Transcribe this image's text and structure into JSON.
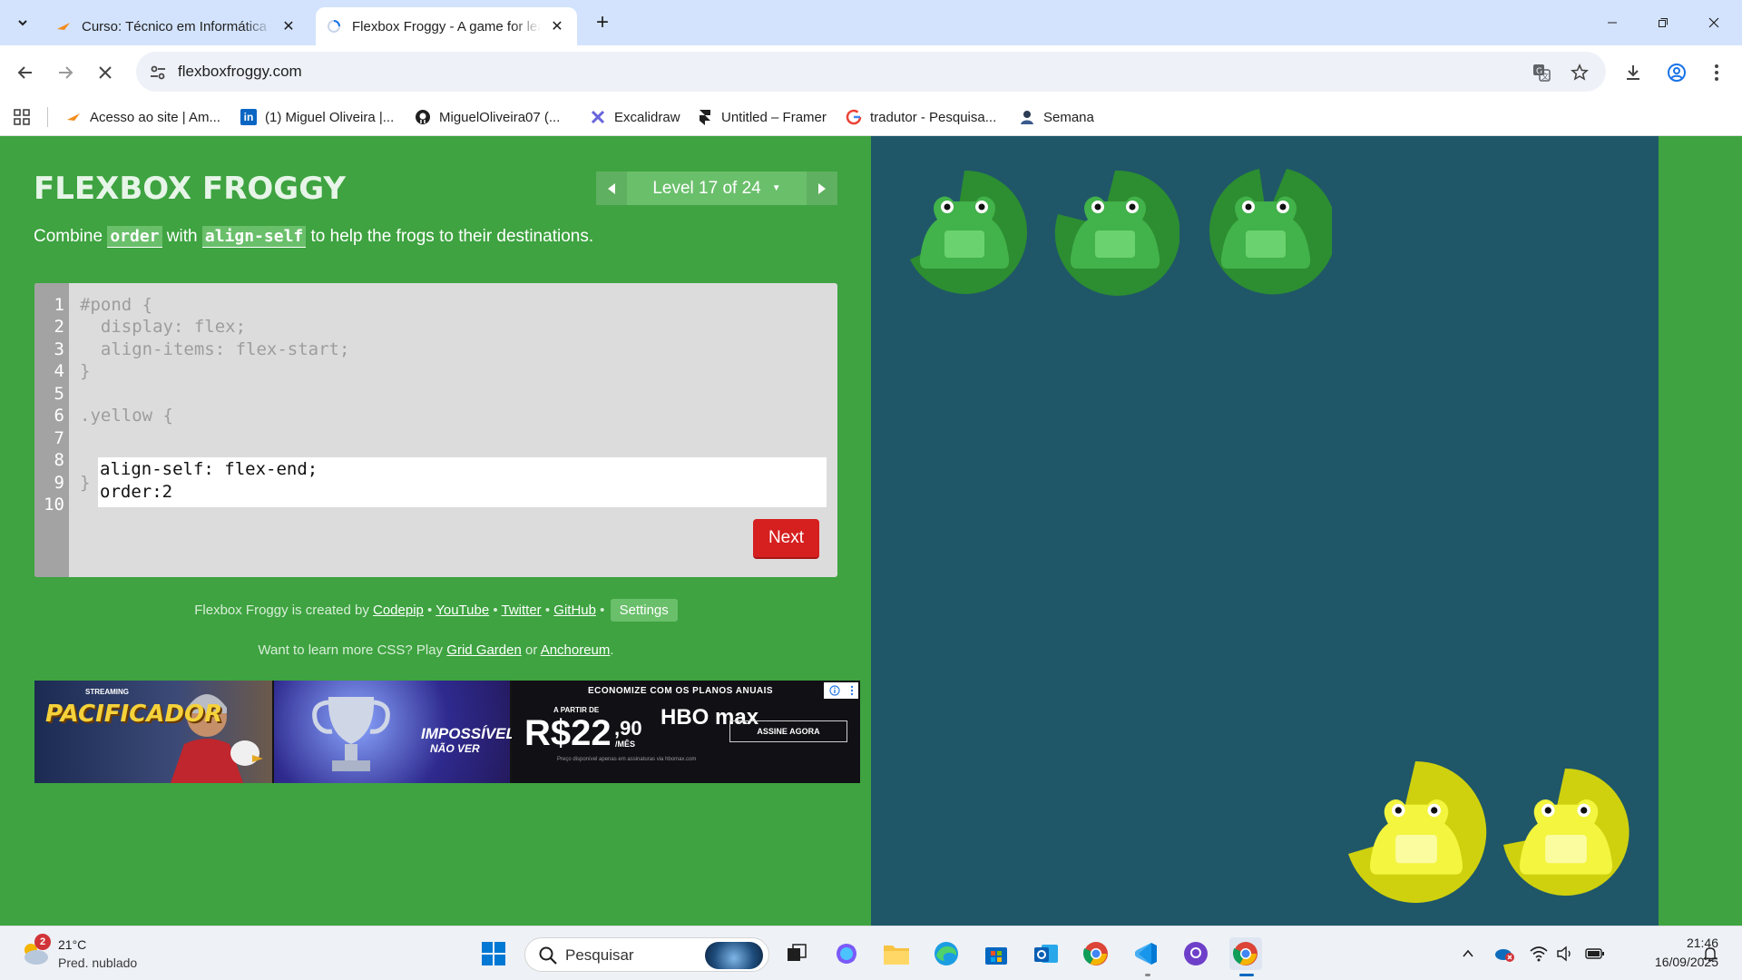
{
  "browser": {
    "tabs": [
      {
        "title": "Curso: Técnico em Informática - ",
        "active": false
      },
      {
        "title": "Flexbox Froggy - A game for lea",
        "active": true
      }
    ],
    "url": "flexboxfroggy.com",
    "bookmarks": [
      {
        "label": "Acesso ao site | Am..."
      },
      {
        "label": "(1) Miguel Oliveira |..."
      },
      {
        "label": "MiguelOliveira07 (..."
      },
      {
        "label": "Excalidraw"
      },
      {
        "label": "Untitled – Framer"
      },
      {
        "label": "tradutor - Pesquisa..."
      },
      {
        "label": "Semana"
      }
    ]
  },
  "game": {
    "logo": "Flexbox Froggy",
    "level_label": "Level 17 of 24",
    "instructions": {
      "prefix": "Combine ",
      "code1": "order",
      "middle": " with ",
      "code2": "align-self",
      "suffix": " to help the frogs to their destinations."
    },
    "editor": {
      "line_numbers": [
        "1",
        "2",
        "3",
        "4",
        "5",
        "6",
        "7",
        "8",
        "9",
        "10"
      ],
      "lines": {
        "l1": "#pond {",
        "l2": "  display: flex;",
        "l3": "  align-items: flex-start;",
        "l4": "}",
        "l6": ".yellow {",
        "l9": "}"
      },
      "input_lines": [
        "align-self: flex-end;",
        "order:2"
      ],
      "next_label": "Next"
    },
    "credits": {
      "prefix": "Flexbox Froggy is created by ",
      "codepip": "Codepip",
      "youtube": "YouTube",
      "twitter": "Twitter",
      "github": "GitHub",
      "settings": "Settings",
      "bullet": " • "
    },
    "learn_more": {
      "prefix": "Want to learn more CSS? Play ",
      "grid": "Grid Garden",
      "or": " or ",
      "anchoreum": "Anchoreum",
      "suffix": "."
    }
  },
  "ad": {
    "panel1_title": "PACIFICADOR",
    "panel1_small": "STREAMING",
    "panel2_title": "IMPOSSÍVEL",
    "panel2_title_b": "NÃO VER",
    "panel3_head": "ECONOMIZE COM OS PLANOS ANUAIS",
    "panel3_from": "A PARTIR DE",
    "panel3_price": "R$22",
    "panel3_cents": ",90",
    "panel3_per": "/MÊS",
    "panel3_brand": "HBO max",
    "panel3_cta": "ASSINE AGORA",
    "panel3_fine": "Preço disponível apenas em assinaturas via hbomax.com"
  },
  "board": {
    "colors": {
      "background": "#1f5768",
      "green_frog": "#42b24a",
      "green_pad": "#2d8d31",
      "yellow_frog": "#f3f53f",
      "yellow_pad": "#cfd10e"
    }
  },
  "taskbar": {
    "weather_badge": "2",
    "temperature": "21°C",
    "weather_desc": "Pred. nublado",
    "search_placeholder": "Pesquisar",
    "time": "21:46",
    "date": "16/09/2025"
  }
}
